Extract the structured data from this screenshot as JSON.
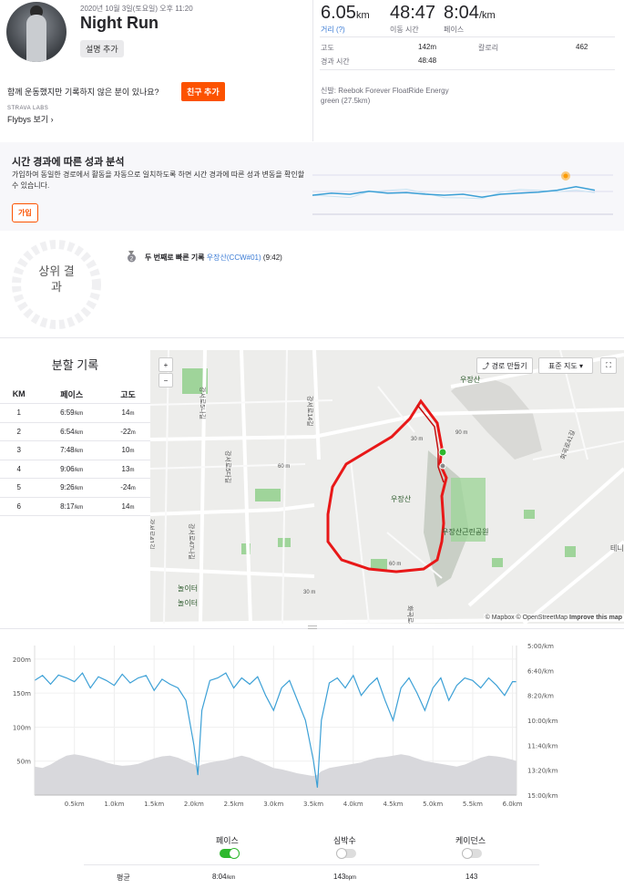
{
  "header": {
    "date": "2020년 10월 3일(토요일) 오후 11:20",
    "title": "Night Run",
    "add_description": "설명 추가",
    "invite_prompt": "함께 운동했지만 기록하지 않은 분이 있나요?",
    "add_friend": "친구 추가",
    "labs_label": "STRAVA LABS",
    "flybys": "Flybys 보기"
  },
  "stats": {
    "distance_value": "6.05",
    "distance_unit": "km",
    "distance_label": "거리 (?)",
    "moving_time_value": "48:47",
    "moving_time_label": "이동 시간",
    "pace_value": "8:04",
    "pace_unit": "/km",
    "pace_label": "페이스",
    "elevation_label": "고도",
    "elevation_value": "142m",
    "calories_label": "칼로리",
    "calories_value": "462",
    "elapsed_label": "경과 시간",
    "elapsed_value": "48:48",
    "shoes_label": "신발:",
    "shoes_value": "Reebok Forever FloatRide Energy green (27.5km)"
  },
  "analysis": {
    "title": "시간 경과에 따른 성과 분석",
    "desc": "가입하여 동일한 경로에서 활동을 자동으로 일치하도록 하면 시간 경과에 따른 성과 변동을 확인할 수 있습니다.",
    "join": "가입",
    "chart_points": [
      0.62,
      0.58,
      0.6,
      0.54,
      0.58,
      0.57,
      0.6,
      0.62,
      0.6,
      0.66,
      0.6,
      0.58,
      0.56,
      0.52,
      0.45,
      0.52
    ]
  },
  "top_results": {
    "label": "상위 결과",
    "medal": "2",
    "achievement": "두 번째로 빠른 기록",
    "segment": "우장산(CCW#01)",
    "time": "(9:42)"
  },
  "splits": {
    "title": "분할 기록",
    "headers": [
      "KM",
      "페이스",
      "고도"
    ],
    "rows": [
      {
        "km": "1",
        "pace": "6:59",
        "pace_unit": "/km",
        "elev": "14",
        "elev_unit": "m"
      },
      {
        "km": "2",
        "pace": "6:54",
        "pace_unit": "/km",
        "elev": "-22",
        "elev_unit": "m"
      },
      {
        "km": "3",
        "pace": "7:48",
        "pace_unit": "/km",
        "elev": "10",
        "elev_unit": "m"
      },
      {
        "km": "4",
        "pace": "9:06",
        "pace_unit": "/km",
        "elev": "13",
        "elev_unit": "m"
      },
      {
        "km": "5",
        "pace": "9:26",
        "pace_unit": "/km",
        "elev": "-24",
        "elev_unit": "m"
      },
      {
        "km": "6",
        "pace": "8:17",
        "pace_unit": "/km",
        "elev": "14",
        "elev_unit": "m"
      }
    ]
  },
  "map": {
    "zoom_in": "+",
    "zoom_out": "−",
    "route_builder": "경로 만들기",
    "map_type": "표준 지도",
    "attribution": "© Mapbox © OpenStreetMap",
    "improve": "Improve this map",
    "labels": [
      "우장산",
      "우장산",
      "우장산근린공원",
      "놀이터",
      "놀이터",
      "90 m",
      "60 m",
      "30 m",
      "60 m",
      "30 m",
      "강서로5나길",
      "강서로5다길",
      "강서로14길",
      "강서로41길",
      "강서로47나길",
      "화곡로41길",
      "화곡로44길",
      "테니"
    ]
  },
  "chart_data": {
    "type": "line",
    "x": [
      0.0,
      0.1,
      0.2,
      0.3,
      0.4,
      0.5,
      0.6,
      0.7,
      0.8,
      0.9,
      1.0,
      1.1,
      1.2,
      1.3,
      1.4,
      1.5,
      1.6,
      1.7,
      1.8,
      1.9,
      2.0,
      2.05,
      2.1,
      2.2,
      2.3,
      2.4,
      2.5,
      2.6,
      2.7,
      2.8,
      2.9,
      3.0,
      3.1,
      3.2,
      3.3,
      3.4,
      3.5,
      3.55,
      3.6,
      3.7,
      3.8,
      3.9,
      4.0,
      4.1,
      4.2,
      4.3,
      4.4,
      4.5,
      4.6,
      4.7,
      4.8,
      4.9,
      5.0,
      5.1,
      5.2,
      5.3,
      5.4,
      5.5,
      5.6,
      5.7,
      5.8,
      5.9,
      6.0,
      6.05
    ],
    "series": [
      {
        "name": "페이스",
        "axis": "right",
        "values_sec_per_km": [
          440,
          420,
          455,
          418,
          430,
          445,
          410,
          470,
          425,
          440,
          460,
          415,
          450,
          430,
          420,
          480,
          435,
          455,
          470,
          520,
          700,
          820,
          560,
          440,
          430,
          410,
          470,
          430,
          455,
          425,
          500,
          560,
          470,
          440,
          520,
          600,
          760,
          870,
          600,
          450,
          430,
          470,
          420,
          500,
          460,
          430,
          520,
          600,
          470,
          430,
          490,
          560,
          470,
          430,
          520,
          460,
          430,
          440,
          470,
          430,
          460,
          500,
          445,
          445
        ]
      },
      {
        "name": "고도",
        "axis": "left",
        "values_m": [
          42,
          40,
          45,
          52,
          58,
          60,
          58,
          55,
          52,
          48,
          45,
          43,
          44,
          46,
          50,
          54,
          57,
          58,
          55,
          50,
          45,
          42,
          45,
          48,
          50,
          52,
          55,
          58,
          55,
          50,
          45,
          40,
          38,
          35,
          32,
          30,
          28,
          30,
          35,
          40,
          42,
          44,
          46,
          48,
          52,
          55,
          56,
          58,
          60,
          58,
          54,
          50,
          48,
          46,
          44,
          42,
          45,
          50,
          55,
          58,
          57,
          55,
          52,
          50
        ]
      }
    ],
    "left_axis_ticks": [
      "200m",
      "150m",
      "100m",
      "50m"
    ],
    "right_axis_ticks": [
      "5:00/km",
      "6:40/km",
      "8:20/km",
      "10:00/km",
      "11:40/km",
      "13:20/km",
      "15:00/km"
    ],
    "x_ticks": [
      "0.5km",
      "1.0km",
      "1.5km",
      "2.0km",
      "2.5km",
      "3.0km",
      "3.5km",
      "4.0km",
      "4.5km",
      "5.0km",
      "5.5km",
      "6.0km"
    ],
    "ylim_left": [
      0,
      220
    ],
    "ylim_right_sec": [
      300,
      900
    ],
    "xlim": [
      0,
      6.05
    ]
  },
  "legend": {
    "pace": "페이스",
    "heart_rate": "심박수",
    "cadence": "케이던스",
    "avg_label": "평균",
    "avg_pace": "8:04",
    "avg_pace_unit": "/km",
    "avg_hr": "143",
    "avg_hr_unit": "bpm",
    "avg_cadence": "143"
  },
  "colors": {
    "strava_orange": "#fc5200",
    "pace_line": "#3ca0d6",
    "elevation_fill": "#d8d8dc",
    "route": "#e81818",
    "park_green": "#9fd49a"
  }
}
